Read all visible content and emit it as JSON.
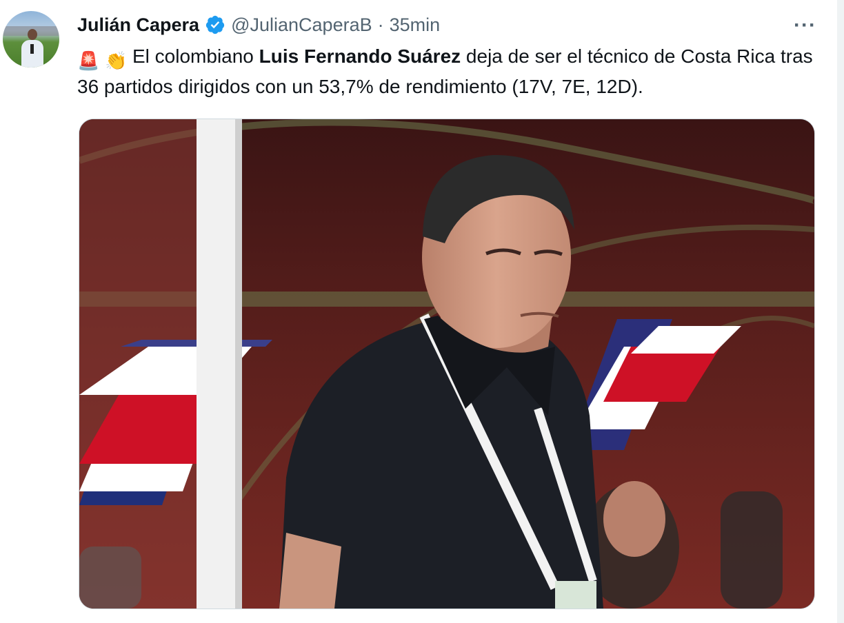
{
  "author": {
    "name": "Julián Capera",
    "handle": "@JulianCaperaB",
    "separator": "·",
    "time": "35min",
    "verified": true
  },
  "tweet": {
    "emoji_1": "🚨",
    "emoji_2": "👏",
    "text_1": "El colombiano ",
    "text_bold": "Luis Fernando Suárez",
    "text_2": " deja de ser el técnico de Costa Rica tras 36 partidos dirigidos con un 53,7% de rendimiento (17V, 7E, 12D).",
    "more_label": "···"
  },
  "colors": {
    "verified_badge": "#1d9bf0",
    "text_primary": "#0f1419",
    "text_secondary": "#536471",
    "flag_red": "#ce1126",
    "flag_blue": "#002b7f"
  }
}
